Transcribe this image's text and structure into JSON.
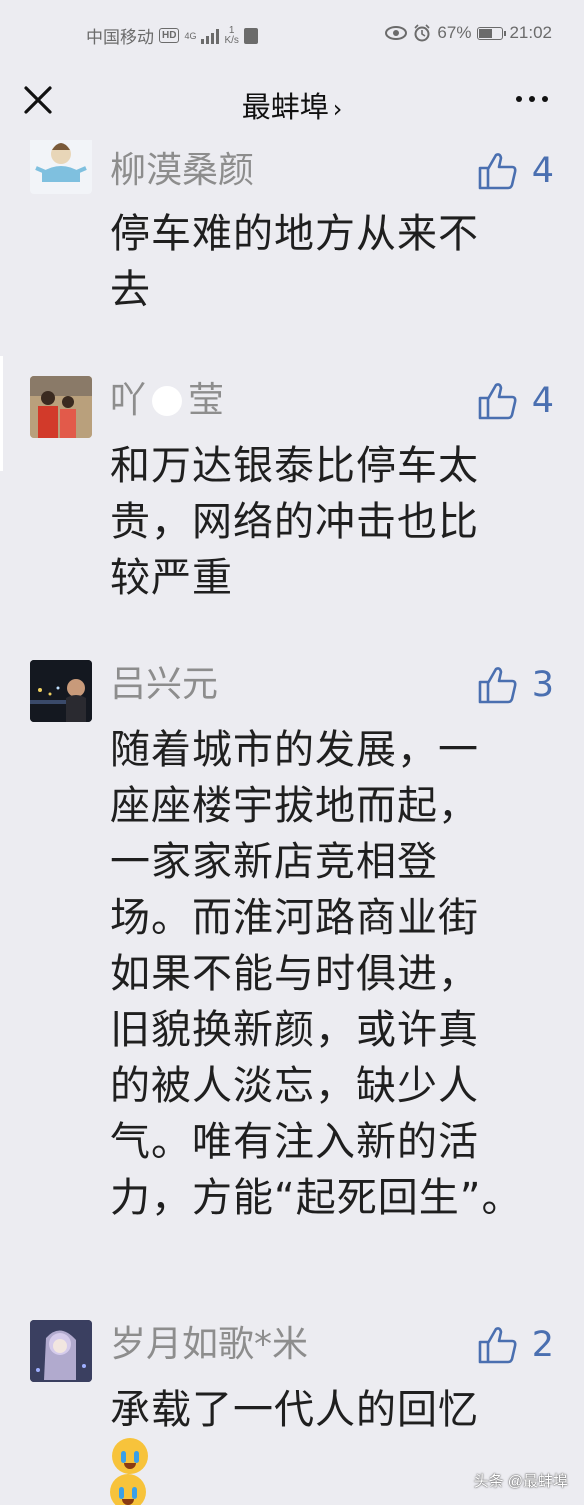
{
  "status_bar": {
    "carrier": "中国移动",
    "hd": "HD",
    "net": "4G",
    "speed_top": "1",
    "speed_unit": "K/s",
    "battery": "67%",
    "battery_level": 0.67,
    "time": "21:02"
  },
  "nav": {
    "title": "最蚌埠",
    "title_chevron": "›",
    "close_icon": "close-icon",
    "more_icon": "more-dots-icon"
  },
  "comments": [
    {
      "user": "柳漠桑颜",
      "likes": "4",
      "lines": [
        "停车难的地方从来不",
        "去"
      ]
    },
    {
      "user_a": "吖",
      "user_b": "莹",
      "likes": "4",
      "lines": [
        "和万达银泰比停车太",
        "贵，网络的冲击也比",
        "较严重"
      ]
    },
    {
      "user": "吕兴元",
      "likes": "3",
      "lines": [
        "随着城市的发展，一",
        "座座楼宇拔地而起，",
        "一家家新店竞相登",
        "场。而淮河路商业街",
        "如果不能与时俱进，",
        "旧貌换新颜，或许真",
        "的被人淡忘，缺少人",
        "气。唯有注入新的活",
        "力，方能“起死回生”。"
      ]
    },
    {
      "user": "岁月如歌*米",
      "likes": "2",
      "lines": [
        "承载了一代人的回忆"
      ]
    }
  ],
  "watermark": "头条 @最蚌埠",
  "colors": {
    "background": "#ececf1",
    "like_blue": "#4a6fb0",
    "username_gray": "#8d8d8d"
  }
}
